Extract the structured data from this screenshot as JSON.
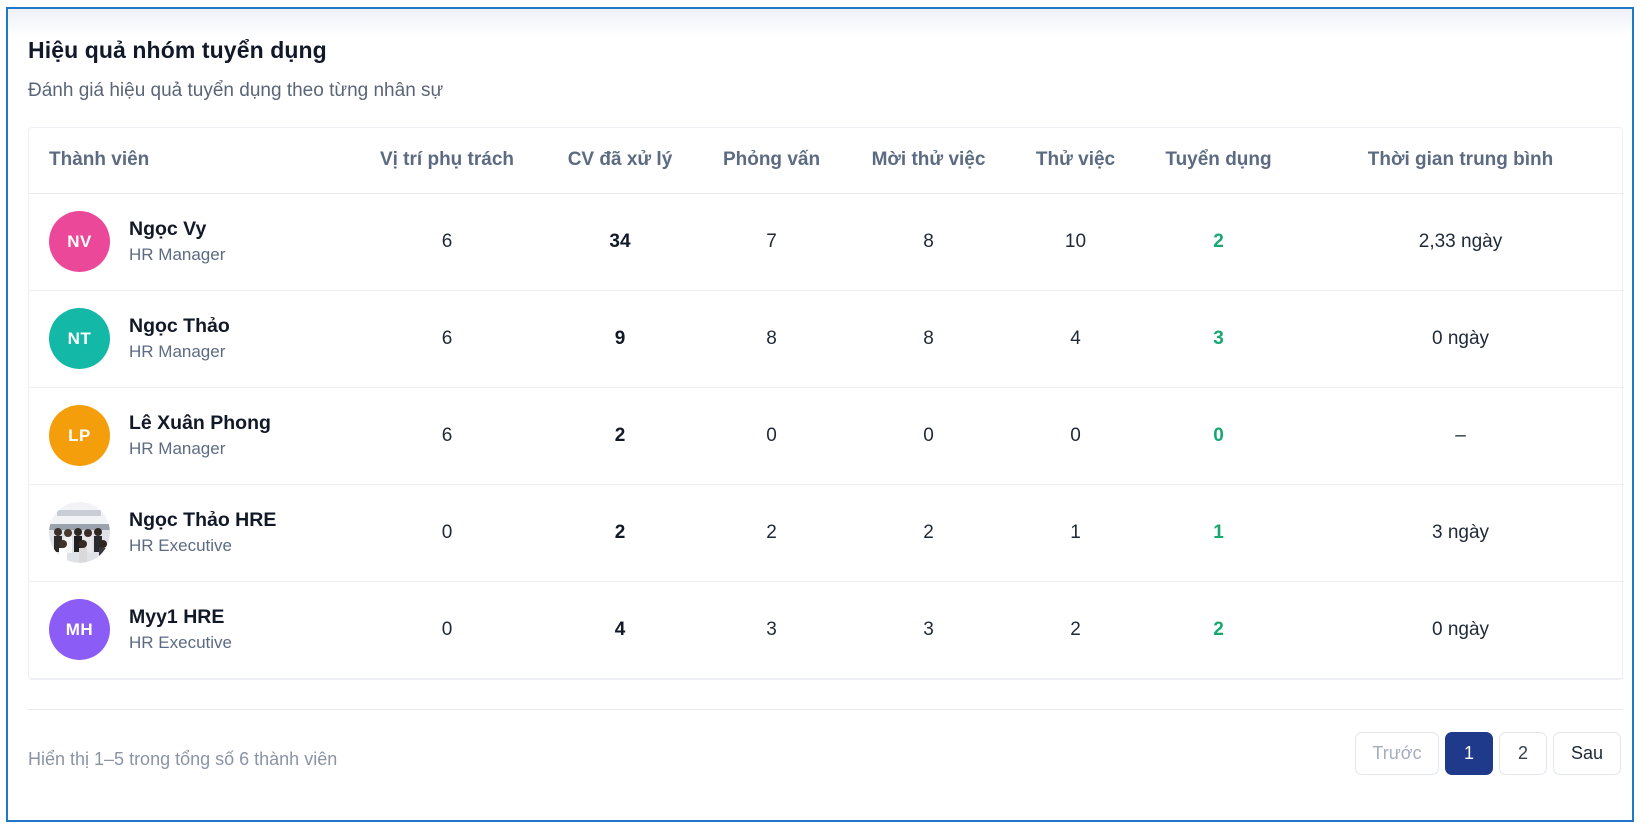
{
  "card": {
    "title": "Hiệu quả nhóm tuyển dụng",
    "subtitle": "Đánh giá hiệu quả tuyển dụng theo từng nhân sự"
  },
  "table": {
    "headers": [
      "Thành viên",
      "Vị trí phụ trách",
      "CV đã xử lý",
      "Phỏng vấn",
      "Mời thử việc",
      "Thử việc",
      "Tuyển dụng",
      "Thời gian trung bình"
    ],
    "rows": [
      {
        "initials": "NV",
        "avatar_color": "#ec4899",
        "name": "Ngọc Vy",
        "role": "HR Manager",
        "positions": "6",
        "cv": "34",
        "interview": "7",
        "trial_invite": "8",
        "trial": "10",
        "hired": "2",
        "avg_time": "2,33 ngày"
      },
      {
        "initials": "NT",
        "avatar_color": "#14b8a6",
        "name": "Ngọc Thảo",
        "role": "HR Manager",
        "positions": "6",
        "cv": "9",
        "interview": "8",
        "trial_invite": "8",
        "trial": "4",
        "hired": "3",
        "avg_time": "0 ngày"
      },
      {
        "initials": "LP",
        "avatar_color": "#f59e0b",
        "name": "Lê Xuân Phong",
        "role": "HR Manager",
        "positions": "6",
        "cv": "2",
        "interview": "0",
        "trial_invite": "0",
        "trial": "0",
        "hired": "0",
        "avg_time": "–"
      },
      {
        "initials": "",
        "avatar_color": "photo",
        "name": "Ngọc Thảo HRE",
        "role": "HR Executive",
        "positions": "0",
        "cv": "2",
        "interview": "2",
        "trial_invite": "2",
        "trial": "1",
        "hired": "1",
        "avg_time": "3 ngày"
      },
      {
        "initials": "MH",
        "avatar_color": "#8b5cf6",
        "name": "Myy1 HRE",
        "role": "HR Executive",
        "positions": "0",
        "cv": "4",
        "interview": "3",
        "trial_invite": "3",
        "trial": "2",
        "hired": "2",
        "avg_time": "0 ngày"
      }
    ]
  },
  "footer": {
    "summary": "Hiển thị 1–5 trong tổng số 6 thành viên"
  },
  "pagination": {
    "prev_label": "Trước",
    "pages": [
      "1",
      "2"
    ],
    "active_page": "1",
    "next_label": "Sau"
  },
  "colors": {
    "accent": "#1f3a8a",
    "hired_green": "#16a870",
    "frame_border": "#1f78c8"
  }
}
